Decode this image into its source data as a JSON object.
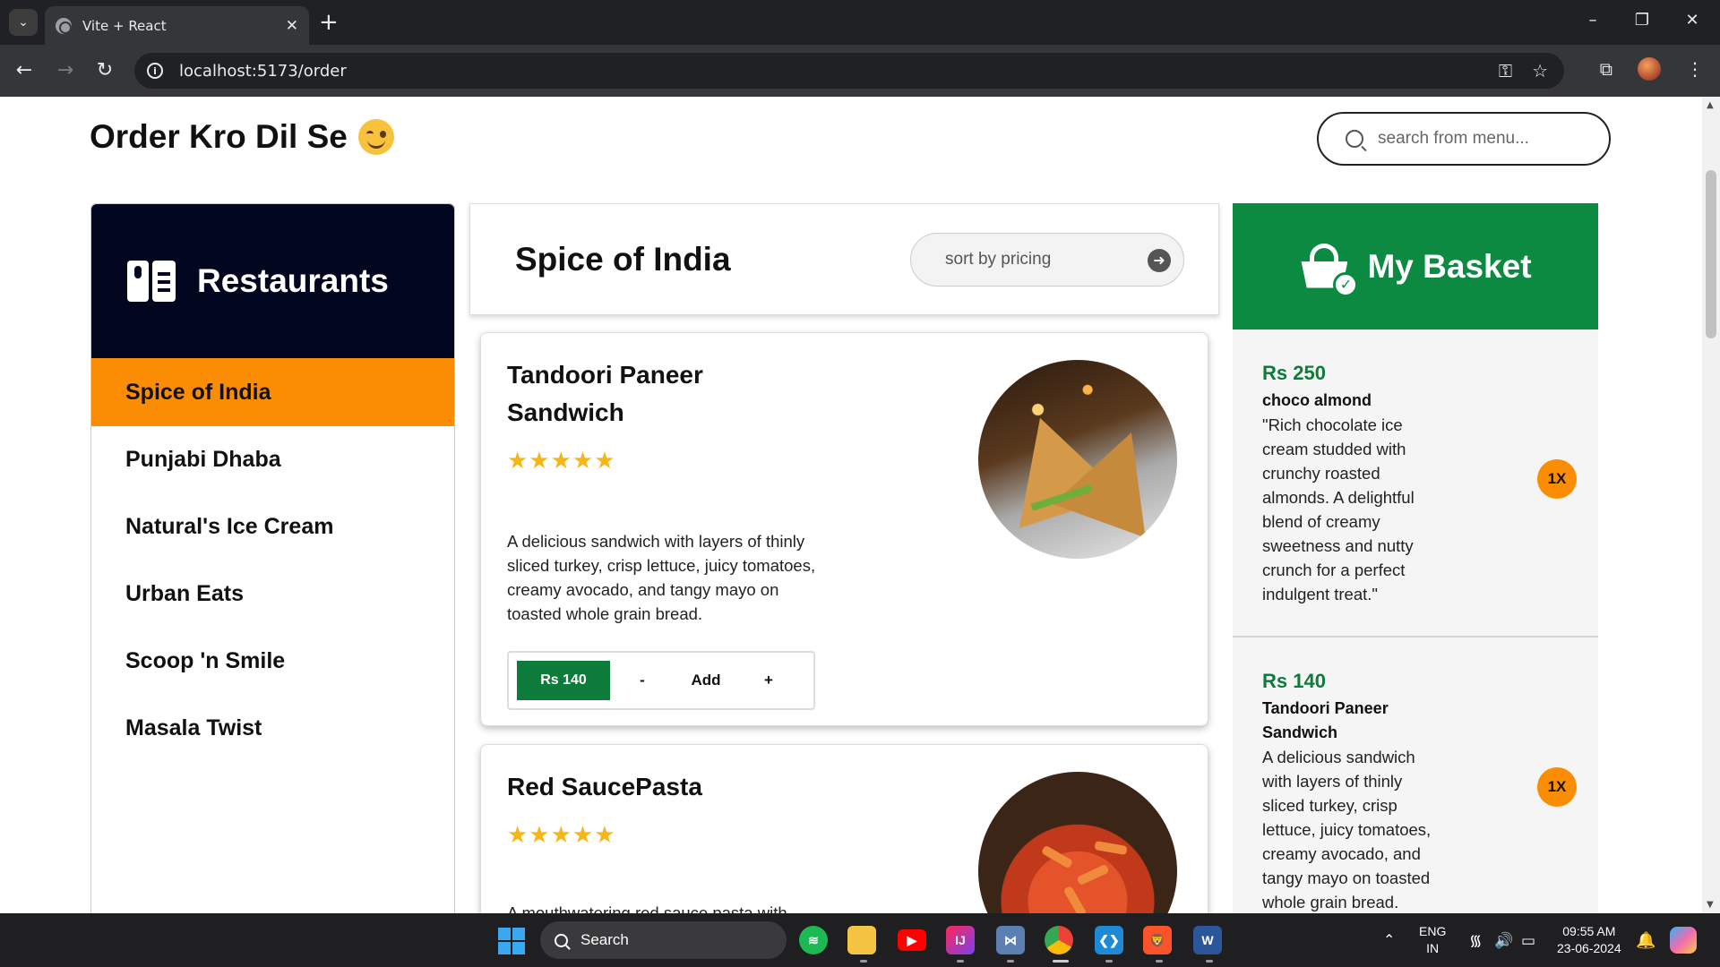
{
  "browser": {
    "tab_title": "Vite + React",
    "url": "localhost:5173/order"
  },
  "header": {
    "title": "Order Kro Dil Se",
    "search_placeholder": "search from menu..."
  },
  "sidebar": {
    "title": "Restaurants",
    "items": [
      {
        "label": "Spice of India",
        "active": true
      },
      {
        "label": "Punjabi Dhaba",
        "active": false
      },
      {
        "label": "Natural's Ice Cream",
        "active": false
      },
      {
        "label": "Urban Eats",
        "active": false
      },
      {
        "label": "Scoop 'n Smile",
        "active": false
      },
      {
        "label": "Masala Twist",
        "active": false
      }
    ]
  },
  "menu": {
    "restaurant_title": "Spice of India",
    "sort_placeholder": "sort by pricing",
    "items": [
      {
        "name": "Tandoori Paneer Sandwich",
        "rating": 5,
        "stars": "★★★★★",
        "description": "A delicious sandwich with layers of thinly sliced turkey, crisp lettuce, juicy tomatoes, creamy avocado, and tangy mayo on toasted whole grain bread.",
        "price_label": "Rs 140",
        "minus_label": "-",
        "add_label": "Add",
        "plus_label": "+"
      },
      {
        "name": "Red SaucePasta",
        "rating": 5,
        "stars": "★★★★★",
        "description": "A mouthwatering red sauce pasta with"
      }
    ]
  },
  "basket": {
    "title": "My Basket",
    "items": [
      {
        "price": "Rs 250",
        "name": "choco almond",
        "description": "\"Rich chocolate ice cream studded with crunchy roasted almonds. A delightful blend of creamy sweetness and nutty crunch for a perfect indulgent treat.\"",
        "qty": "1X"
      },
      {
        "price": "Rs 140",
        "name": "Tandoori Paneer Sandwich",
        "description": "A delicious sandwich with layers of thinly sliced turkey, crisp lettuce, juicy tomatoes, creamy avocado, and tangy mayo on toasted whole grain bread.",
        "qty": "1X"
      }
    ]
  },
  "taskbar": {
    "search_label": "Search",
    "lang_line1": "ENG",
    "lang_line2": "IN",
    "time": "09:55 AM",
    "date": "23-06-2024"
  },
  "colors": {
    "accent_orange": "#fb8d05",
    "basket_green": "#0d8a42",
    "price_green": "#0d7c3b",
    "sidebar_navy": "#03061f",
    "star_gold": "#f7b518"
  }
}
